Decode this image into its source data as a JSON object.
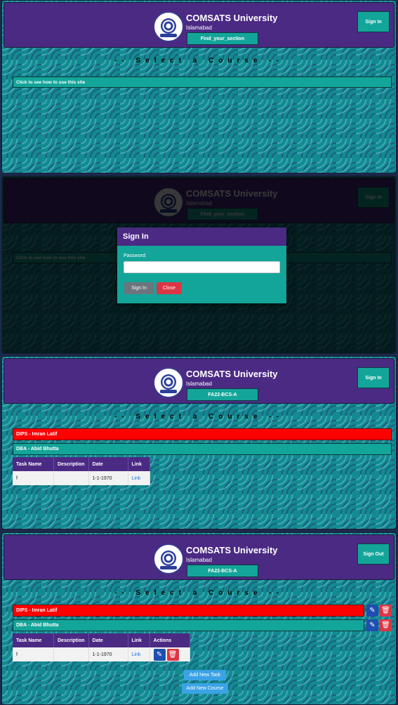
{
  "header": {
    "title": "COMSATS University",
    "subtitle": "Islamabad",
    "section_default": "Find_your_section",
    "section_selected": "FA22-BCS-A",
    "sign_in": "Sign In",
    "sign_out": "Sign Out"
  },
  "main": {
    "select_title": "-- Select a Course --",
    "howto": "Click to see how to use this site"
  },
  "modal": {
    "title": "Sign In",
    "password_label": "Password:",
    "signin_btn": "Sign In",
    "close_btn": "Close"
  },
  "courses": [
    {
      "label": "DIPS - Imran Latif",
      "color": "#ff0000"
    },
    {
      "label": "DBA - Abid Bhutta",
      "color": "#14a59a"
    }
  ],
  "table": {
    "headers": [
      "Task Name",
      "Description",
      "Date",
      "Link"
    ],
    "actions_header": "Actions",
    "rows": [
      {
        "task": "f",
        "desc": "",
        "date": "1-1-1970",
        "link": "Link"
      }
    ]
  },
  "buttons": {
    "add_task": "Add New Task",
    "add_course": "Add New Course"
  },
  "colors": {
    "purple": "#4b2a84",
    "teal": "#14a59a",
    "red": "#ff0000",
    "blue": "#3aa3e6"
  }
}
